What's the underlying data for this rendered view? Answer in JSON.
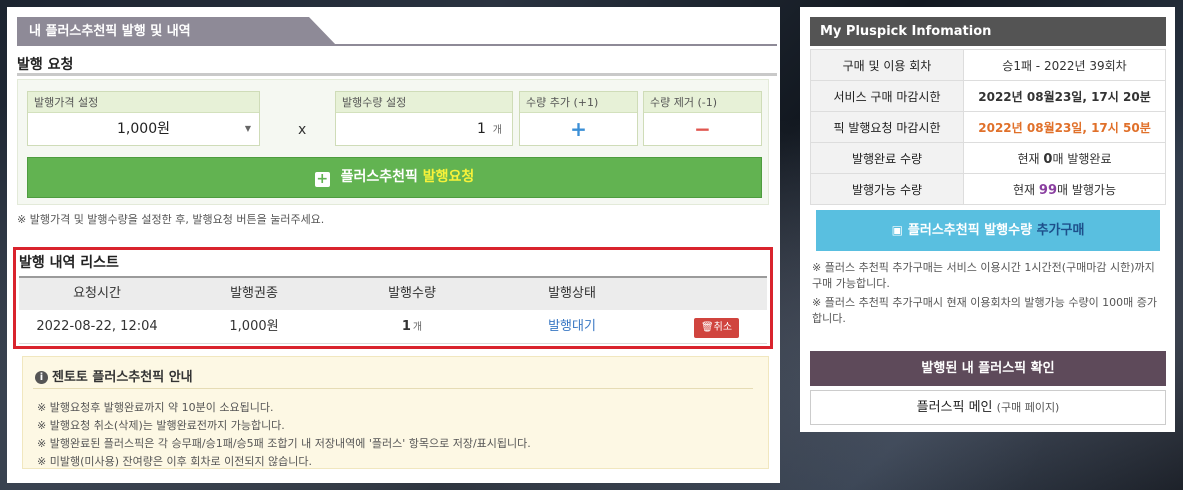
{
  "left": {
    "tab_title": "내 플러스추천픽 발행 및 내역",
    "request": {
      "title": "발행 요청",
      "price_label": "발행가격 설정",
      "price_value": "1,000원",
      "multiply": "x",
      "qty_label": "발행수량 설정",
      "qty_value": "1",
      "qty_unit": "개",
      "add_label": "수량 추가 (+1)",
      "add_symbol": "+",
      "remove_label": "수량 제거 (-1)",
      "remove_symbol": "−",
      "submit_plus": "+",
      "submit_label": "플러스추천픽",
      "submit_highlight": "발행요청",
      "note": "※ 발행가격 및 발행수량을 설정한 후, 발행요청 버튼을 눌러주세요."
    },
    "history": {
      "title": "발행 내역 리스트",
      "columns": [
        "요청시간",
        "발행권종",
        "발행수량",
        "발행상태"
      ],
      "rows": [
        {
          "time": "2022-08-22, 12:04",
          "type": "1,000원",
          "qty": "1",
          "qty_unit": "개",
          "status": "발행대기",
          "cancel": "취소"
        }
      ]
    },
    "info": {
      "title": "젠토토 플러스추천픽 안내",
      "lines": [
        "※ 발행요청후 발행완료까지 약 10분이 소요됩니다.",
        "※ 발행요청 취소(삭제)는 발행완료전까지 가능합니다.",
        "※ 발행완료된 플러스픽은 각 승무패/승1패/승5패 조합기 내 저장내역에 '플러스' 항목으로 저장/표시됩니다.",
        "※ 미발행(미사용) 잔여량은 이후 회차로 이전되지 않습니다."
      ]
    }
  },
  "right": {
    "header": "My Pluspick Infomation",
    "rows": [
      {
        "label": "구매 및 이용 회차",
        "value": "승1패 - 2022년 39회차"
      },
      {
        "label": "서비스 구매 마감시한",
        "value": "2022년 08월23일, 17시 20분"
      },
      {
        "label": "픽 발행요청 마감시한",
        "value": "2022년 08월23일, 17시 50분"
      }
    ],
    "completed": {
      "label": "발행완료 수량",
      "prefix": "현재",
      "count": "0",
      "suffix": "매 발행완료"
    },
    "available": {
      "label": "발행가능 수량",
      "prefix": "현재",
      "count": "99",
      "suffix": "매 발행가능"
    },
    "buy_button": {
      "label": "플러스추천픽 발행수량",
      "highlight": "추가구매"
    },
    "notes": [
      "※ 플러스 추천픽 추가구매는 서비스 이용시간 1시간전(구매마감 시한)까지 구매 가능합니다.",
      "※ 플러스 추천픽 추가구매시 현재 이용회차의 발행가능 수량이 100매 증가합니다."
    ],
    "confirm_button": "발행된 내 플러스픽 확인",
    "main_button": {
      "label": "플러스픽 메인",
      "sub": "(구매 페이지)"
    }
  },
  "colors": {
    "green": "#62b351",
    "yellow_highlight": "#f7f23a",
    "red_border": "#d9232d",
    "blue": "#59bfe0",
    "purple": "#5e4a5a",
    "orange_deadline": "#e0702a",
    "purple_count": "#8a3fa0",
    "link_blue": "#3a78c4"
  }
}
